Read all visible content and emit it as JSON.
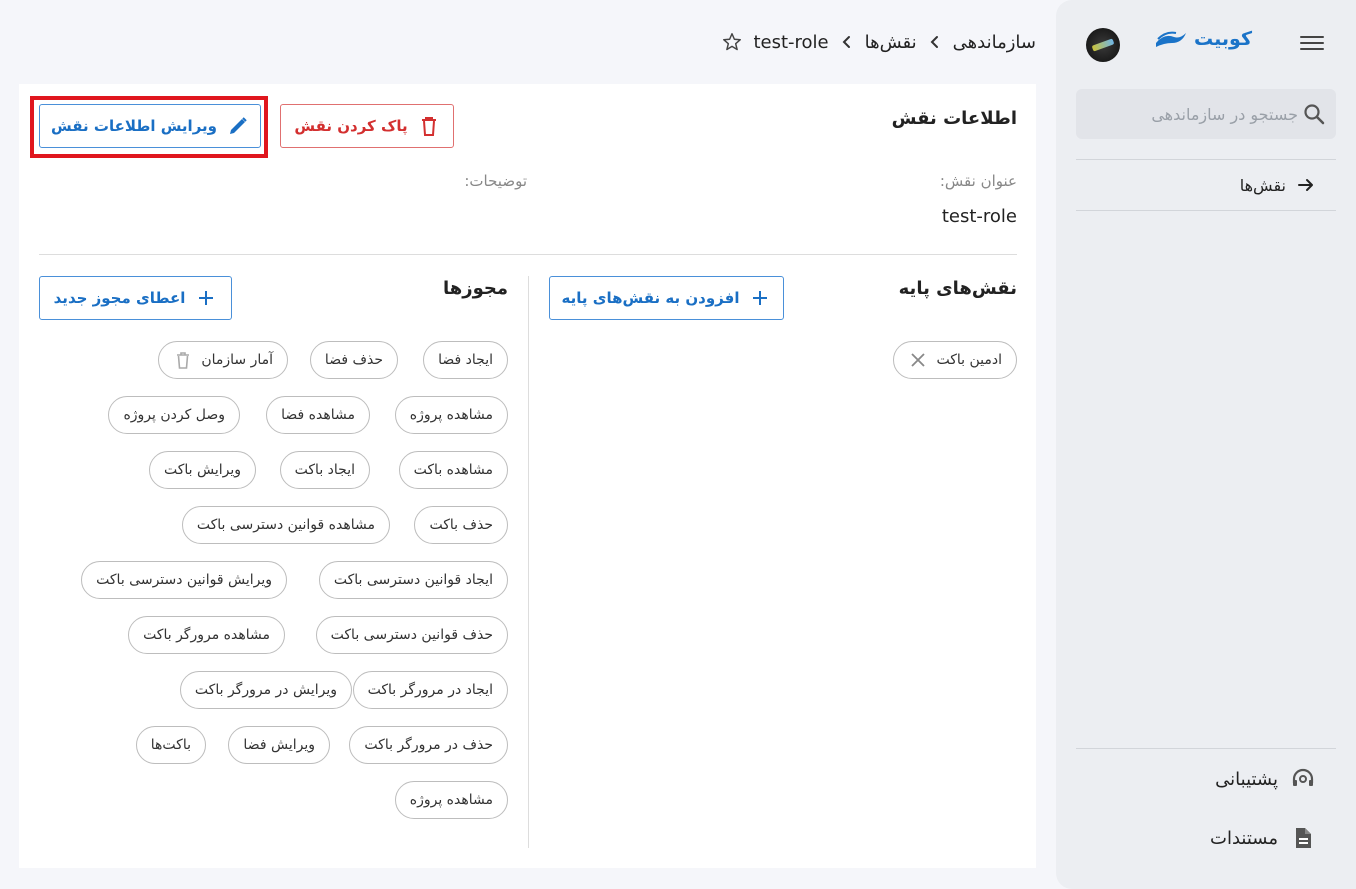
{
  "sidebar": {
    "logo_text": "کوبیت",
    "search_placeholder": "جستجو در سازماندهی",
    "nav": [
      {
        "label": "نقش‌ها"
      }
    ],
    "bottom": [
      {
        "label": "پشتیبانی"
      },
      {
        "label": "مستندات"
      }
    ]
  },
  "breadcrumb": [
    "سازماندهی",
    "نقش‌ها",
    "test-role"
  ],
  "role": {
    "section_title": "اطلاعات نقش",
    "edit_label": "ویرایش اطلاعات نقش",
    "delete_label": "پاک کردن نقش",
    "title_label": "عنوان نقش:",
    "title_value": "test-role",
    "description_label": "توضیحات:"
  },
  "base_roles": {
    "title": "نقش‌های پایه",
    "add_label": "افزودن به نقش‌های پایه",
    "items": [
      "ادمین باکت"
    ]
  },
  "permissions": {
    "title": "مجوزها",
    "add_label": "اعطای مجوز جدید",
    "items": [
      "ایجاد فضا",
      "حذف فضا",
      "آمار سازمان",
      "مشاهده پروژه",
      "مشاهده فضا",
      "وصل کردن پروژه",
      "مشاهده باکت",
      "ایجاد باکت",
      "ویرایش باکت",
      "حذف باکت",
      "مشاهده قوانین دسترسی باکت",
      "ایجاد قوانین دسترسی باکت",
      "ویرایش قوانین دسترسی باکت",
      "حذف قوانین دسترسی باکت",
      "مشاهده مرورگر باکت",
      "ایجاد در مرورگر باکت",
      "ویرایش در مرورگر باکت",
      "حذف در مرورگر باکت",
      "ویرایش فضا",
      "باکت‌ها",
      "مشاهده پروژه"
    ]
  },
  "colors": {
    "accent": "#1a6fc4",
    "danger": "#d32f2f",
    "highlight": "#e0161e"
  }
}
